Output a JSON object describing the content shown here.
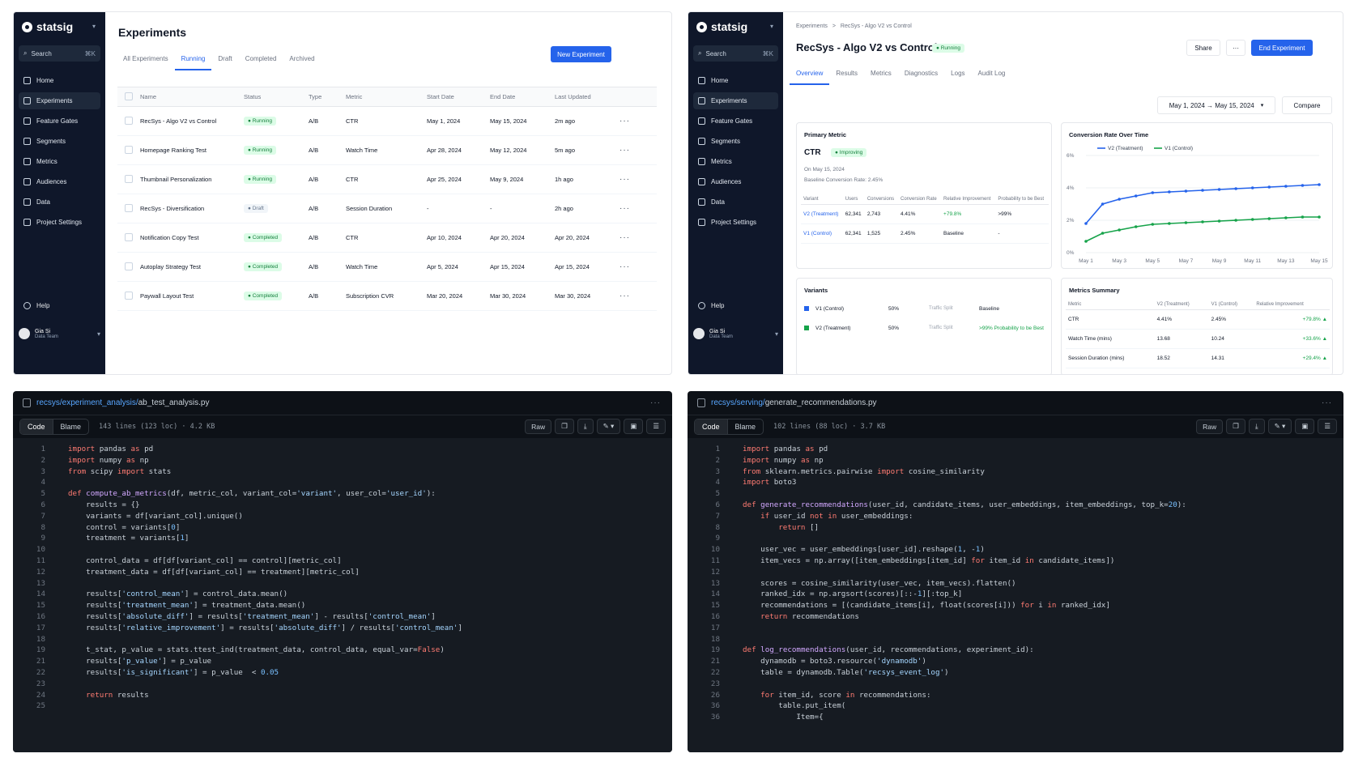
{
  "sidebar": {
    "brand": "statsig",
    "search_label": "Search",
    "search_shortcut": "⌘K",
    "items": [
      "Home",
      "Experiments",
      "Feature Gates",
      "Segments",
      "Metrics",
      "Audiences",
      "Data",
      "Project Settings"
    ],
    "active": "Experiments",
    "help": "Help",
    "user_name": "Gia Si",
    "user_team": "Data Team"
  },
  "experiments_page": {
    "title": "Experiments",
    "tabs": [
      "All Experiments",
      "Running",
      "Draft",
      "Completed",
      "Archived"
    ],
    "active_tab": "Running",
    "new_button": "New Experiment",
    "columns": [
      "Name",
      "Status",
      "Type",
      "Metric",
      "Start Date",
      "End Date",
      "Last Updated"
    ],
    "rows": [
      {
        "name": "RecSys - Algo V2 vs Control",
        "status": "Running",
        "type": "A/B",
        "metric": "CTR",
        "start": "May 1, 2024",
        "end": "May 15, 2024",
        "updated": "2m ago"
      },
      {
        "name": "Homepage Ranking Test",
        "status": "Running",
        "type": "A/B",
        "metric": "Watch Time",
        "start": "Apr 28, 2024",
        "end": "May 12, 2024",
        "updated": "5m ago"
      },
      {
        "name": "Thumbnail Personalization",
        "status": "Running",
        "type": "A/B",
        "metric": "CTR",
        "start": "Apr 25, 2024",
        "end": "May 9, 2024",
        "updated": "1h ago"
      },
      {
        "name": "RecSys - Diversification",
        "status": "Draft",
        "type": "A/B",
        "metric": "Session Duration",
        "start": "-",
        "end": "-",
        "updated": "2h ago"
      },
      {
        "name": "Notification Copy Test",
        "status": "Completed",
        "type": "A/B",
        "metric": "CTR",
        "start": "Apr 10, 2024",
        "end": "Apr 20, 2024",
        "updated": "Apr 20, 2024"
      },
      {
        "name": "Autoplay Strategy Test",
        "status": "Completed",
        "type": "A/B",
        "metric": "Watch Time",
        "start": "Apr 5, 2024",
        "end": "Apr 15, 2024",
        "updated": "Apr 15, 2024"
      },
      {
        "name": "Paywall Layout Test",
        "status": "Completed",
        "type": "A/B",
        "metric": "Subscription CVR",
        "start": "Mar 20, 2024",
        "end": "Mar 30, 2024",
        "updated": "Mar 30, 2024"
      }
    ]
  },
  "detail_page": {
    "breadcrumb_root": "Experiments",
    "breadcrumb_sep": ">",
    "breadcrumb_leaf": "RecSys - Algo V2 vs Control",
    "title": "RecSys - Algo V2 vs Control",
    "status": "Running",
    "share": "Share",
    "more": "···",
    "end_button": "End Experiment",
    "tabs": [
      "Overview",
      "Results",
      "Metrics",
      "Diagnostics",
      "Logs",
      "Audit Log"
    ],
    "active_tab": "Overview",
    "date_range": "May 1, 2024  →  May 15, 2024",
    "compare": "Compare",
    "primary": {
      "heading": "Primary Metric",
      "metric": "CTR",
      "trend": "Improving",
      "date": "On May 15, 2024",
      "baseline": "Baseline Conversion Rate: 2.45%",
      "columns": [
        "Variant",
        "Users",
        "Conversions",
        "Conversion Rate",
        "Relative Improvement",
        "Probability to be Best"
      ],
      "rows": [
        {
          "variant": "V2 (Treatment)",
          "users": "62,341",
          "conv": "2,743",
          "rate": "4.41%",
          "rel": "+79.8%",
          "prob": ">99%"
        },
        {
          "variant": "V1 (Control)",
          "users": "62,341",
          "conv": "1,525",
          "rate": "2.45%",
          "rel": "Baseline",
          "prob": "-"
        }
      ]
    },
    "variants": {
      "heading": "Variants",
      "rows": [
        {
          "name": "V1 (Control)",
          "split": "50%",
          "label": "Traffic Split",
          "note": "Baseline",
          "color": "#2563eb"
        },
        {
          "name": "V2 (Treatment)",
          "split": "50%",
          "label": "Traffic Split",
          "note": ">99% Probability to be Best",
          "color": "#16a34a"
        }
      ]
    },
    "summary": {
      "heading": "Metrics Summary",
      "columns": [
        "Metric",
        "V2 (Treatment)",
        "V1 (Control)",
        "Relative Improvement"
      ],
      "rows": [
        {
          "metric": "CTR",
          "v2": "4.41%",
          "v1": "2.45%",
          "rel": "+79.8% ▲"
        },
        {
          "metric": "Watch Time (mins)",
          "v2": "13.68",
          "v1": "10.24",
          "rel": "+33.6% ▲"
        },
        {
          "metric": "Session Duration (mins)",
          "v2": "18.52",
          "v1": "14.31",
          "rel": "+29.4% ▲"
        }
      ]
    }
  },
  "chart_data": {
    "type": "line",
    "title": "Conversion Rate Over Time",
    "x": [
      "May 1",
      "May 2",
      "May 3",
      "May 4",
      "May 5",
      "May 6",
      "May 7",
      "May 8",
      "May 9",
      "May 10",
      "May 11",
      "May 12",
      "May 13",
      "May 14",
      "May 15"
    ],
    "xticks": [
      "May 1",
      "May 3",
      "May 5",
      "May 7",
      "May 9",
      "May 11",
      "May 13",
      "May 15"
    ],
    "yticks": [
      "0%",
      "2%",
      "4%",
      "6%"
    ],
    "ylim": [
      0,
      6
    ],
    "series": [
      {
        "name": "V2 (Treatment)",
        "color": "#2563eb",
        "values": [
          1.8,
          3.0,
          3.3,
          3.5,
          3.7,
          3.75,
          3.8,
          3.85,
          3.9,
          3.95,
          4.0,
          4.05,
          4.1,
          4.15,
          4.2
        ]
      },
      {
        "name": "V1 (Control)",
        "color": "#16a34a",
        "values": [
          0.7,
          1.2,
          1.4,
          1.6,
          1.75,
          1.8,
          1.85,
          1.9,
          1.95,
          2.0,
          2.05,
          2.1,
          2.15,
          2.2,
          2.2
        ]
      }
    ],
    "legend": "top-left",
    "grid": true
  },
  "code1": {
    "path_dir": "recsys/experiment_analysis/",
    "file": "ab_test_analysis.py",
    "tab_code": "Code",
    "tab_blame": "Blame",
    "meta": "143 lines (123 loc) · 4.2 KB",
    "raw": "Raw",
    "lines": [
      "import pandas as pd",
      "import numpy as np",
      "from scipy import stats",
      "",
      "def compute_ab_metrics(df, metric_col, variant_col='variant', user_col='user_id'):",
      "    results = {}",
      "    variants = df[variant_col].unique()",
      "    control = variants[0]",
      "    treatment = variants[1]",
      "",
      "    control_data = df[df[variant_col] == control][metric_col]",
      "    treatment_data = df[df[variant_col] == treatment][metric_col]",
      "",
      "    results['control_mean'] = control_data.mean()",
      "    results['treatment_mean'] = treatment_data.mean()",
      "    results['absolute_diff'] = results['treatment_mean'] - results['control_mean']",
      "    results['relative_improvement'] = results['absolute_diff'] / results['control_mean']",
      "",
      "    t_stat, p_value = stats.ttest_ind(treatment_data, control_data, equal_var=False)",
      "    results['p_value'] = p_value",
      "    results['is_significant'] = p_value  < 0.05",
      "",
      "    return results",
      ""
    ],
    "numbers": [
      "1",
      "2",
      "3",
      "4",
      "5",
      "6",
      "7",
      "8",
      "9",
      "10",
      "11",
      "12",
      "13",
      "14",
      "15",
      "16",
      "17",
      "18",
      "19",
      "21",
      "22",
      "23",
      "24",
      "25"
    ]
  },
  "code2": {
    "path_dir": "recsys/serving/",
    "file": "generate_recommendations.py",
    "tab_code": "Code",
    "tab_blame": "Blame",
    "meta": "102 lines (88 loc) · 3.7 KB",
    "raw": "Raw",
    "lines": [
      "import pandas as pd",
      "import numpy as np",
      "from sklearn.metrics.pairwise import cosine_similarity",
      "import boto3",
      "",
      "def generate_recommendations(user_id, candidate_items, user_embeddings, item_embeddings, top_k=20):",
      "    if user_id not in user_embeddings:",
      "        return []",
      "",
      "    user_vec = user_embeddings[user_id].reshape(1, -1)",
      "    item_vecs = np.array([item_embeddings[item_id] for item_id in candidate_items])",
      "",
      "    scores = cosine_similarity(user_vec, item_vecs).flatten()",
      "    ranked_idx = np.argsort(scores)[::-1][:top_k]",
      "    recommendations = [(candidate_items[i], float(scores[i])) for i in ranked_idx]",
      "    return recommendations",
      "",
      "",
      "def log_recommendations(user_id, recommendations, experiment_id):",
      "    dynamodb = boto3.resource('dynamodb')",
      "    table = dynamodb.Table('recsys_event_log')",
      "",
      "    for item_id, score in recommendations:",
      "        table.put_item(",
      "            Item={"
    ],
    "numbers": [
      "1",
      "2",
      "3",
      "4",
      "5",
      "6",
      "7",
      "8",
      "9",
      "10",
      "11",
      "12",
      "13",
      "14",
      "15",
      "16",
      "17",
      "18",
      "19",
      "21",
      "22",
      "23",
      "26",
      "36",
      "36"
    ]
  }
}
